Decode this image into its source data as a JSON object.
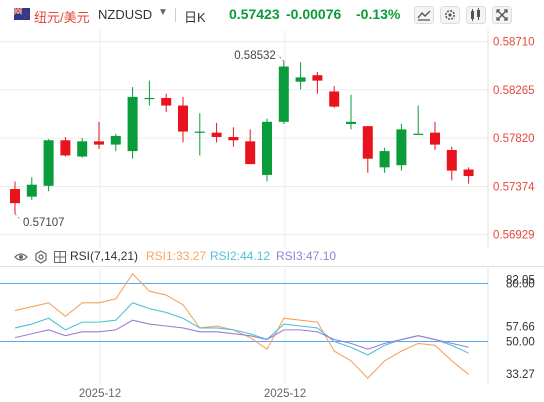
{
  "header": {
    "pair_cn": "纽元/美元",
    "symbol": "NZDUSD",
    "period": "日K",
    "price": "0.57423",
    "change": "-0.00076",
    "change_pct": "-0.13%"
  },
  "colors": {
    "up": "#0a9b3a",
    "down": "#e8131c",
    "price_text": "#e8463a",
    "rsi1": "#f4a460",
    "rsi2": "#4fc3d9",
    "rsi3": "#9b7fd4",
    "ref_line": "#5aa8f0"
  },
  "chart_data": [
    {
      "type": "candlestick",
      "title": "NZDUSD",
      "y_ticks": [
        "0.58710",
        "0.58265",
        "0.57820",
        "0.57374",
        "0.56929"
      ],
      "ylim": [
        0.5688,
        0.5878
      ],
      "x_ticks": [
        "2025-12",
        "2025-12"
      ],
      "annotations": {
        "high": "0.58532",
        "low": "0.57107"
      },
      "candles": [
        {
          "o": 0.5735,
          "h": 0.5742,
          "l": 0.5712,
          "c": 0.5722
        },
        {
          "o": 0.5728,
          "h": 0.5746,
          "l": 0.5725,
          "c": 0.5739
        },
        {
          "o": 0.5738,
          "h": 0.5781,
          "l": 0.5733,
          "c": 0.578
        },
        {
          "o": 0.578,
          "h": 0.5783,
          "l": 0.5765,
          "c": 0.5766
        },
        {
          "o": 0.5765,
          "h": 0.5782,
          "l": 0.5764,
          "c": 0.5779
        },
        {
          "o": 0.5779,
          "h": 0.5797,
          "l": 0.5772,
          "c": 0.5776
        },
        {
          "o": 0.5776,
          "h": 0.5786,
          "l": 0.577,
          "c": 0.5784
        },
        {
          "o": 0.577,
          "h": 0.5829,
          "l": 0.5763,
          "c": 0.582
        },
        {
          "o": 0.5818,
          "h": 0.5835,
          "l": 0.5812,
          "c": 0.5819
        },
        {
          "o": 0.5819,
          "h": 0.5823,
          "l": 0.5806,
          "c": 0.5812
        },
        {
          "o": 0.5812,
          "h": 0.582,
          "l": 0.5778,
          "c": 0.5788
        },
        {
          "o": 0.5787,
          "h": 0.5805,
          "l": 0.5766,
          "c": 0.5788
        },
        {
          "o": 0.5787,
          "h": 0.5796,
          "l": 0.5778,
          "c": 0.5783
        },
        {
          "o": 0.5783,
          "h": 0.5792,
          "l": 0.5774,
          "c": 0.578
        },
        {
          "o": 0.5779,
          "h": 0.579,
          "l": 0.5765,
          "c": 0.5758
        },
        {
          "o": 0.5748,
          "h": 0.58,
          "l": 0.5742,
          "c": 0.5797
        },
        {
          "o": 0.5797,
          "h": 0.5853,
          "l": 0.5795,
          "c": 0.5848
        },
        {
          "o": 0.5834,
          "h": 0.5852,
          "l": 0.5827,
          "c": 0.5838
        },
        {
          "o": 0.584,
          "h": 0.5843,
          "l": 0.5823,
          "c": 0.5835
        },
        {
          "o": 0.5825,
          "h": 0.583,
          "l": 0.581,
          "c": 0.5811
        },
        {
          "o": 0.5795,
          "h": 0.5822,
          "l": 0.579,
          "c": 0.5797
        },
        {
          "o": 0.5793,
          "h": 0.5793,
          "l": 0.575,
          "c": 0.5763
        },
        {
          "o": 0.5755,
          "h": 0.5773,
          "l": 0.575,
          "c": 0.577
        },
        {
          "o": 0.5757,
          "h": 0.5795,
          "l": 0.5752,
          "c": 0.579
        },
        {
          "o": 0.5786,
          "h": 0.5812,
          "l": 0.5785,
          "c": 0.5786
        },
        {
          "o": 0.5787,
          "h": 0.5797,
          "l": 0.5771,
          "c": 0.5776
        },
        {
          "o": 0.5771,
          "h": 0.5774,
          "l": 0.5743,
          "c": 0.5752
        },
        {
          "o": 0.5753,
          "h": 0.5755,
          "l": 0.574,
          "c": 0.5747
        }
      ]
    },
    {
      "type": "line",
      "title": "RSI(7,14,21)",
      "legend": [
        "RSI1:33.27",
        "RSI2:44.12",
        "RSI3:47.10"
      ],
      "y_ticks": [
        "80.00",
        "82.05",
        "57.66",
        "50.00",
        "33.27"
      ],
      "ylim": [
        28,
        88
      ],
      "ref_lines": [
        80,
        50
      ],
      "series": [
        {
          "name": "RSI1",
          "values": [
            66,
            68,
            70,
            63,
            70,
            70,
            72,
            85,
            76,
            74,
            69,
            57,
            58,
            56,
            52,
            46,
            62,
            61,
            60,
            45,
            40,
            31,
            40,
            45,
            49,
            48,
            40,
            33
          ]
        },
        {
          "name": "RSI2",
          "values": [
            57,
            59,
            62,
            56,
            60,
            60,
            61,
            70,
            67,
            65,
            62,
            57,
            57,
            56,
            54,
            51,
            59,
            58,
            57,
            50,
            47,
            43,
            48,
            51,
            53,
            51,
            48,
            44
          ]
        },
        {
          "name": "RSI3",
          "values": [
            52,
            54,
            56,
            53,
            55,
            55,
            56,
            61,
            59,
            58,
            57,
            55,
            55,
            54,
            53,
            51,
            56,
            56,
            55,
            51,
            49,
            46,
            49,
            51,
            53,
            51,
            49,
            47
          ]
        }
      ]
    }
  ]
}
